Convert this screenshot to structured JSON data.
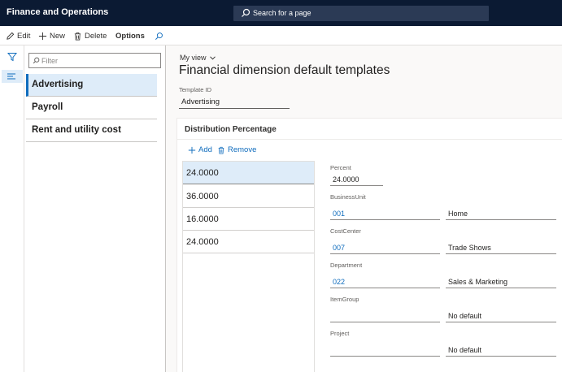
{
  "app": {
    "title": "Finance and Operations"
  },
  "search": {
    "placeholder": "Search for a page"
  },
  "actions": {
    "edit": "Edit",
    "new": "New",
    "delete": "Delete",
    "options": "Options"
  },
  "list": {
    "filter_placeholder": "Filter",
    "items": [
      "Advertising",
      "Payroll",
      "Rent and utility cost"
    ]
  },
  "detail": {
    "my_view": "My view",
    "title": "Financial dimension default templates",
    "template_id_label": "Template ID",
    "template_id_value": "Advertising",
    "section_title": "Distribution Percentage",
    "add_label": "Add",
    "remove_label": "Remove",
    "grid_rows": [
      "24.0000",
      "36.0000",
      "16.0000",
      "24.0000"
    ],
    "percent_label": "Percent",
    "percent_value": "24.0000",
    "dimensions": [
      {
        "label": "BusinessUnit",
        "value": "001",
        "description": "Home"
      },
      {
        "label": "CostCenter",
        "value": "007",
        "description": "Trade Shows"
      },
      {
        "label": "Department",
        "value": "022",
        "description": "Sales & Marketing"
      },
      {
        "label": "ItemGroup",
        "value": "",
        "description": "No default"
      },
      {
        "label": "Project",
        "value": "",
        "description": "No default"
      }
    ]
  },
  "colors": {
    "top_bar": "#0b1a33",
    "accent": "#0f6cbd",
    "selection": "#deecf9"
  }
}
